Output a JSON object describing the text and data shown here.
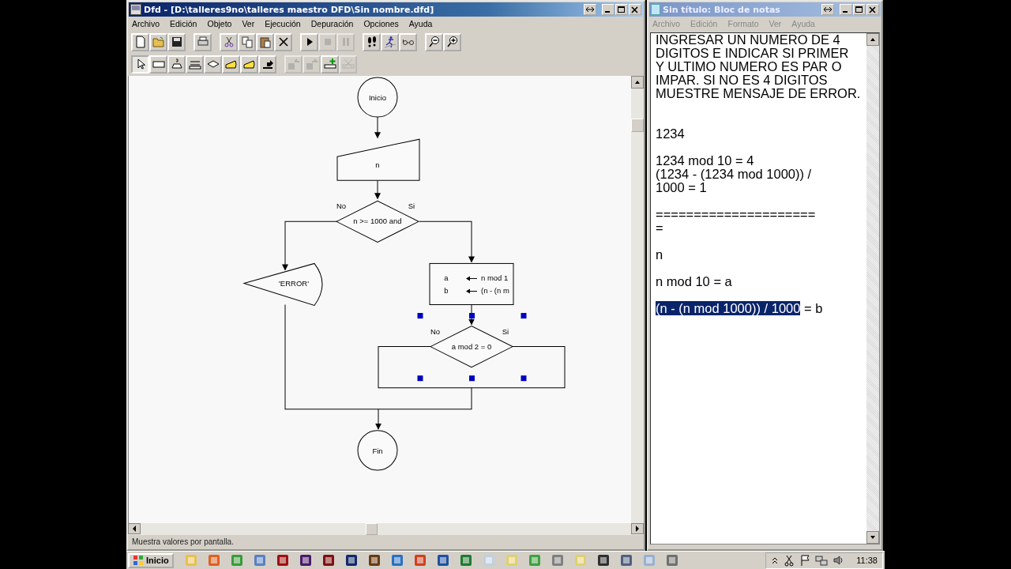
{
  "dfd_window": {
    "title": "Dfd - [D:\\talleres9no\\talleres maestro DFD\\Sin nombre.dfd]",
    "menu": [
      "Archivo",
      "Edición",
      "Objeto",
      "Ver",
      "Ejecución",
      "Depuración",
      "Opciones",
      "Ayuda"
    ],
    "toolbar_rows": [
      [
        [
          {
            "kind": "new",
            "disabled": false
          },
          {
            "kind": "open",
            "disabled": false
          },
          {
            "kind": "save",
            "disabled": false
          }
        ],
        [
          {
            "kind": "print",
            "disabled": false
          }
        ],
        [
          {
            "kind": "cut",
            "disabled": false
          },
          {
            "kind": "copy",
            "disabled": false
          },
          {
            "kind": "paste",
            "disabled": false
          },
          {
            "kind": "delete",
            "disabled": false
          }
        ],
        [
          {
            "kind": "run",
            "disabled": false
          },
          {
            "kind": "stop",
            "disabled": true
          },
          {
            "kind": "pause",
            "disabled": true
          }
        ],
        [
          {
            "kind": "step",
            "disabled": false
          },
          {
            "kind": "runner",
            "disabled": false
          },
          {
            "kind": "glasses",
            "disabled": false
          }
        ],
        [
          {
            "kind": "zoom_out",
            "disabled": false
          },
          {
            "kind": "zoom_in",
            "disabled": false
          }
        ]
      ],
      [
        [
          {
            "kind": "pointer",
            "disabled": false,
            "selected": true
          },
          {
            "kind": "process",
            "disabled": false,
            "selected": false
          },
          {
            "kind": "read",
            "disabled": false,
            "selected": false
          },
          {
            "kind": "loop",
            "disabled": false,
            "selected": false
          },
          {
            "kind": "decision",
            "disabled": false,
            "selected": false
          },
          {
            "kind": "output",
            "disabled": false,
            "selected": false
          },
          {
            "kind": "output",
            "disabled": false,
            "selected": false
          },
          {
            "kind": "call",
            "disabled": false,
            "selected": false
          }
        ],
        [
          {
            "kind": "sub_left",
            "disabled": true,
            "selected": false
          },
          {
            "kind": "sub_right",
            "disabled": true,
            "selected": false
          },
          {
            "kind": "sub_add",
            "disabled": false,
            "selected": false
          },
          {
            "kind": "sub_delete",
            "disabled": true,
            "selected": false
          }
        ]
      ]
    ],
    "flowchart": {
      "nodes": [
        {
          "kind": "start",
          "text": "Inicio",
          "selected": false
        },
        {
          "kind": "input",
          "text": "n",
          "selected": false
        },
        {
          "kind": "decision",
          "text": "n >= 1000 and",
          "no_label": "No",
          "yes_label": "Si",
          "selected": false
        },
        {
          "kind": "output",
          "text": "'ERROR'",
          "selected": false
        },
        {
          "kind": "assign",
          "rows": [
            {
              "var": "a",
              "expr": "n mod 1"
            },
            {
              "var": "b",
              "expr": "(n - (n m"
            }
          ],
          "selected": false
        },
        {
          "kind": "decision",
          "text": "a mod 2 = 0",
          "no_label": "No",
          "yes_label": "Si",
          "selected": true
        },
        {
          "kind": "end",
          "text": "Fin",
          "selected": false
        }
      ]
    },
    "status_bar": "Muestra valores por pantalla."
  },
  "notepad": {
    "title": "Sin título: Bloc de notas",
    "menu": [
      "Archivo",
      "Edición",
      "Formato",
      "Ver",
      "Ayuda"
    ],
    "lines": [
      {
        "kind": "text",
        "parts": [
          {
            "text": "INGRESAR UN NUMERO DE 4",
            "selected": false
          }
        ]
      },
      {
        "kind": "text",
        "parts": [
          {
            "text": "DIGITOS E INDICAR SI PRIMER",
            "selected": false
          }
        ]
      },
      {
        "kind": "text",
        "parts": [
          {
            "text": "Y ULTIMO NUMERO ES PAR O",
            "selected": false
          }
        ]
      },
      {
        "kind": "text",
        "parts": [
          {
            "text": "IMPAR. SI NO ES 4 DIGITOS",
            "selected": false
          }
        ]
      },
      {
        "kind": "text",
        "parts": [
          {
            "text": "MUESTRE MENSAJE DE ERROR.",
            "selected": false
          }
        ]
      },
      {
        "kind": "blank"
      },
      {
        "kind": "blank"
      },
      {
        "kind": "text",
        "parts": [
          {
            "text": "1234",
            "selected": false
          }
        ]
      },
      {
        "kind": "blank"
      },
      {
        "kind": "text",
        "parts": [
          {
            "text": "1234 mod 10 = 4",
            "selected": false
          }
        ]
      },
      {
        "kind": "text",
        "parts": [
          {
            "text": "(1234 - (1234 mod 1000)) /",
            "selected": false
          }
        ]
      },
      {
        "kind": "text",
        "parts": [
          {
            "text": "1000 = 1",
            "selected": false
          }
        ]
      },
      {
        "kind": "blank"
      },
      {
        "kind": "text",
        "parts": [
          {
            "text": "=====================",
            "selected": false
          }
        ]
      },
      {
        "kind": "text",
        "parts": [
          {
            "text": "=",
            "selected": false
          }
        ]
      },
      {
        "kind": "blank"
      },
      {
        "kind": "text",
        "parts": [
          {
            "text": "n",
            "selected": false
          }
        ]
      },
      {
        "kind": "blank"
      },
      {
        "kind": "text",
        "parts": [
          {
            "text": "n mod 10 = a",
            "selected": false
          }
        ]
      },
      {
        "kind": "blank"
      },
      {
        "kind": "text",
        "parts": [
          {
            "text": "(n - (n mod 1000)) / 1000",
            "selected": true
          },
          {
            "text": " = b",
            "selected": false
          }
        ]
      }
    ]
  },
  "taskbar": {
    "start_label": "Inicio",
    "clock": "11:38"
  }
}
